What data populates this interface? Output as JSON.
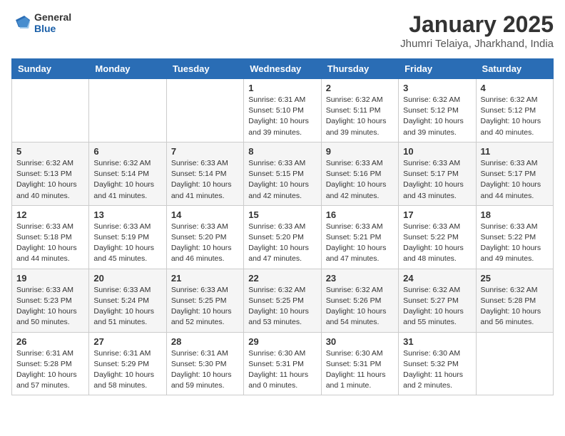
{
  "logo": {
    "general": "General",
    "blue": "Blue"
  },
  "header": {
    "title": "January 2025",
    "subtitle": "Jhumri Telaiya, Jharkhand, India"
  },
  "weekdays": [
    "Sunday",
    "Monday",
    "Tuesday",
    "Wednesday",
    "Thursday",
    "Friday",
    "Saturday"
  ],
  "weeks": [
    [
      {
        "day": "",
        "info": ""
      },
      {
        "day": "",
        "info": ""
      },
      {
        "day": "",
        "info": ""
      },
      {
        "day": "1",
        "info": "Sunrise: 6:31 AM\nSunset: 5:10 PM\nDaylight: 10 hours\nand 39 minutes."
      },
      {
        "day": "2",
        "info": "Sunrise: 6:32 AM\nSunset: 5:11 PM\nDaylight: 10 hours\nand 39 minutes."
      },
      {
        "day": "3",
        "info": "Sunrise: 6:32 AM\nSunset: 5:12 PM\nDaylight: 10 hours\nand 39 minutes."
      },
      {
        "day": "4",
        "info": "Sunrise: 6:32 AM\nSunset: 5:12 PM\nDaylight: 10 hours\nand 40 minutes."
      }
    ],
    [
      {
        "day": "5",
        "info": "Sunrise: 6:32 AM\nSunset: 5:13 PM\nDaylight: 10 hours\nand 40 minutes."
      },
      {
        "day": "6",
        "info": "Sunrise: 6:32 AM\nSunset: 5:14 PM\nDaylight: 10 hours\nand 41 minutes."
      },
      {
        "day": "7",
        "info": "Sunrise: 6:33 AM\nSunset: 5:14 PM\nDaylight: 10 hours\nand 41 minutes."
      },
      {
        "day": "8",
        "info": "Sunrise: 6:33 AM\nSunset: 5:15 PM\nDaylight: 10 hours\nand 42 minutes."
      },
      {
        "day": "9",
        "info": "Sunrise: 6:33 AM\nSunset: 5:16 PM\nDaylight: 10 hours\nand 42 minutes."
      },
      {
        "day": "10",
        "info": "Sunrise: 6:33 AM\nSunset: 5:17 PM\nDaylight: 10 hours\nand 43 minutes."
      },
      {
        "day": "11",
        "info": "Sunrise: 6:33 AM\nSunset: 5:17 PM\nDaylight: 10 hours\nand 44 minutes."
      }
    ],
    [
      {
        "day": "12",
        "info": "Sunrise: 6:33 AM\nSunset: 5:18 PM\nDaylight: 10 hours\nand 44 minutes."
      },
      {
        "day": "13",
        "info": "Sunrise: 6:33 AM\nSunset: 5:19 PM\nDaylight: 10 hours\nand 45 minutes."
      },
      {
        "day": "14",
        "info": "Sunrise: 6:33 AM\nSunset: 5:20 PM\nDaylight: 10 hours\nand 46 minutes."
      },
      {
        "day": "15",
        "info": "Sunrise: 6:33 AM\nSunset: 5:20 PM\nDaylight: 10 hours\nand 47 minutes."
      },
      {
        "day": "16",
        "info": "Sunrise: 6:33 AM\nSunset: 5:21 PM\nDaylight: 10 hours\nand 47 minutes."
      },
      {
        "day": "17",
        "info": "Sunrise: 6:33 AM\nSunset: 5:22 PM\nDaylight: 10 hours\nand 48 minutes."
      },
      {
        "day": "18",
        "info": "Sunrise: 6:33 AM\nSunset: 5:22 PM\nDaylight: 10 hours\nand 49 minutes."
      }
    ],
    [
      {
        "day": "19",
        "info": "Sunrise: 6:33 AM\nSunset: 5:23 PM\nDaylight: 10 hours\nand 50 minutes."
      },
      {
        "day": "20",
        "info": "Sunrise: 6:33 AM\nSunset: 5:24 PM\nDaylight: 10 hours\nand 51 minutes."
      },
      {
        "day": "21",
        "info": "Sunrise: 6:33 AM\nSunset: 5:25 PM\nDaylight: 10 hours\nand 52 minutes."
      },
      {
        "day": "22",
        "info": "Sunrise: 6:32 AM\nSunset: 5:25 PM\nDaylight: 10 hours\nand 53 minutes."
      },
      {
        "day": "23",
        "info": "Sunrise: 6:32 AM\nSunset: 5:26 PM\nDaylight: 10 hours\nand 54 minutes."
      },
      {
        "day": "24",
        "info": "Sunrise: 6:32 AM\nSunset: 5:27 PM\nDaylight: 10 hours\nand 55 minutes."
      },
      {
        "day": "25",
        "info": "Sunrise: 6:32 AM\nSunset: 5:28 PM\nDaylight: 10 hours\nand 56 minutes."
      }
    ],
    [
      {
        "day": "26",
        "info": "Sunrise: 6:31 AM\nSunset: 5:28 PM\nDaylight: 10 hours\nand 57 minutes."
      },
      {
        "day": "27",
        "info": "Sunrise: 6:31 AM\nSunset: 5:29 PM\nDaylight: 10 hours\nand 58 minutes."
      },
      {
        "day": "28",
        "info": "Sunrise: 6:31 AM\nSunset: 5:30 PM\nDaylight: 10 hours\nand 59 minutes."
      },
      {
        "day": "29",
        "info": "Sunrise: 6:30 AM\nSunset: 5:31 PM\nDaylight: 11 hours\nand 0 minutes."
      },
      {
        "day": "30",
        "info": "Sunrise: 6:30 AM\nSunset: 5:31 PM\nDaylight: 11 hours\nand 1 minute."
      },
      {
        "day": "31",
        "info": "Sunrise: 6:30 AM\nSunset: 5:32 PM\nDaylight: 11 hours\nand 2 minutes."
      },
      {
        "day": "",
        "info": ""
      }
    ]
  ]
}
